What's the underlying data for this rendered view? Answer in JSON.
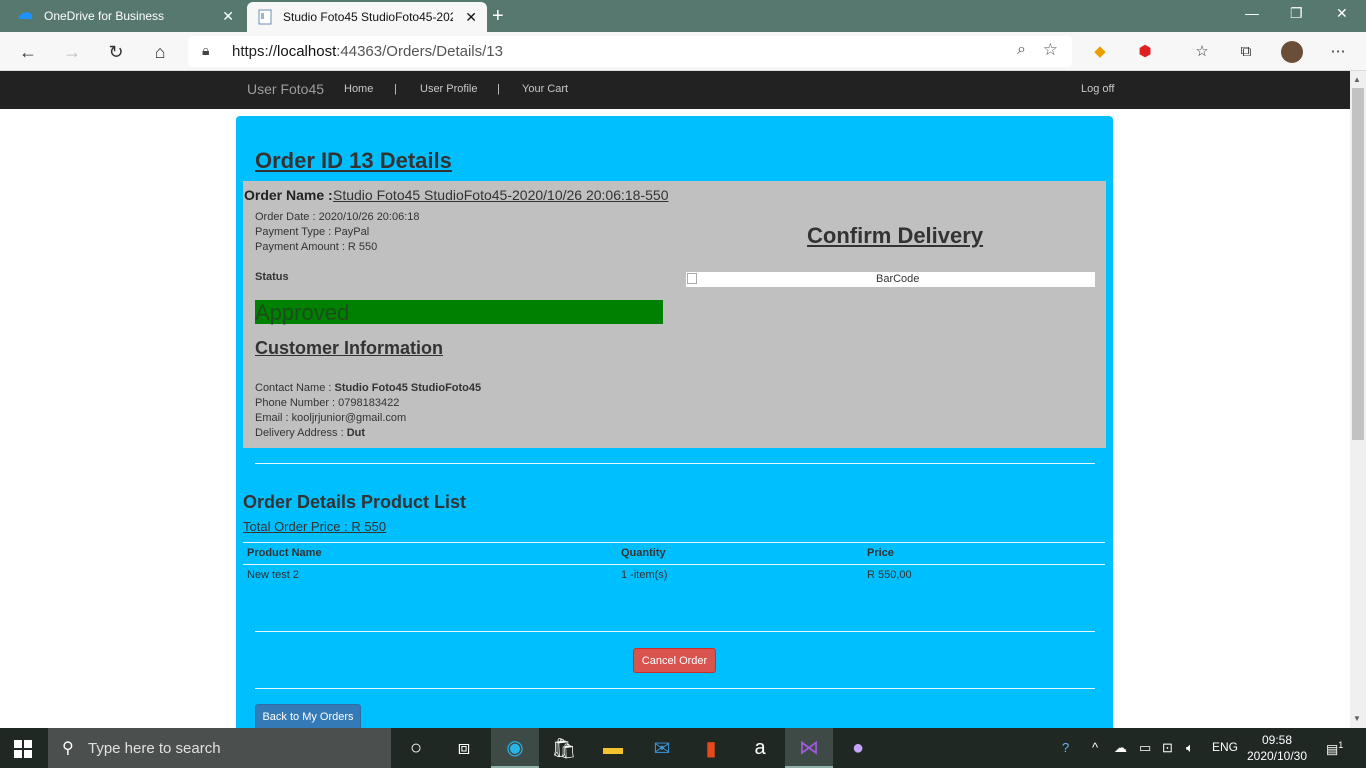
{
  "browser": {
    "tabs": [
      {
        "label": "OneDrive for Business",
        "icon": "onedrive-icon"
      },
      {
        "label": "Studio Foto45 StudioFoto45-202",
        "icon": "page-icon"
      }
    ],
    "url_prefix": "https://",
    "url_host": "localhost",
    "url_rest": ":44363/Orders/Details/13"
  },
  "site_nav": {
    "brand": "User Foto45",
    "items": [
      "Home",
      "User Profile",
      "Your Cart"
    ],
    "separator": "|",
    "logoff": "Log off"
  },
  "order": {
    "heading": "Order ID 13 Details",
    "name_label": "Order Name :",
    "name_value": "Studio Foto45 StudioFoto45-2020/10/26 20:06:18-550",
    "date": "Order Date : 2020/10/26 20:06:18",
    "payment_type": "Payment Type : PayPal",
    "payment_amount": "Payment Amount : R 550",
    "status_label": "Status",
    "status_value": "Approved",
    "confirm_heading": "Confirm Delivery",
    "barcode_alt": "BarCode"
  },
  "customer": {
    "heading": "Customer Information",
    "contact_label": "Contact Name : ",
    "contact_value": "Studio Foto45 StudioFoto45",
    "phone": "Phone Number : 0798183422",
    "email": "Email : kooljrjunior@gmail.com",
    "address_label": "Delivery Address : ",
    "address_value": "Dut"
  },
  "products": {
    "heading": "Order Details Product List",
    "total": "Total Order Price : R 550",
    "columns": [
      "Product Name",
      "Quantity",
      "Price"
    ],
    "rows": [
      [
        "New test 2",
        "1 -item(s)",
        "R 550,00"
      ]
    ]
  },
  "actions": {
    "cancel": "Cancel Order",
    "back": "Back to My Orders"
  },
  "taskbar": {
    "search_placeholder": "Type here to search",
    "lang": "ENG",
    "time": "09:58",
    "date": "2020/10/30",
    "notification_count": "1"
  },
  "colors": {
    "panel": "#00bfff",
    "status_approved": "#008000",
    "cancel_button": "#d9534f",
    "back_button": "#337ab7"
  }
}
